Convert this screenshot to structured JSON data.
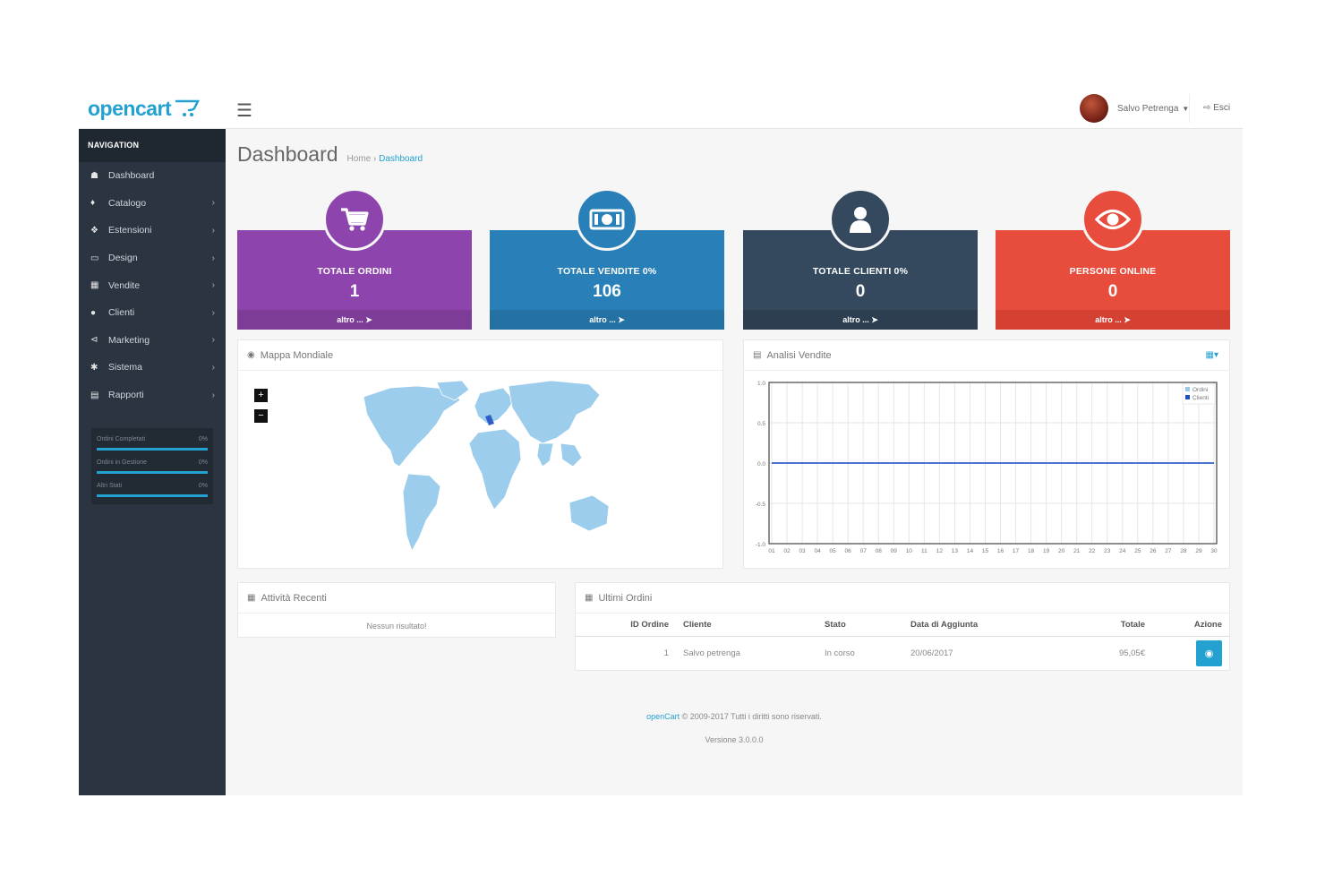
{
  "brand": {
    "logo_text": "opencart"
  },
  "header": {
    "menu_icon": "hamburger-icon",
    "user_name": "Salvo Petrenga",
    "logout_label": "Esci"
  },
  "sidebar": {
    "heading": "NAVIGATION",
    "items": [
      {
        "label": "Dashboard",
        "icon": "dashboard-icon",
        "has_children": false
      },
      {
        "label": "Catalogo",
        "icon": "tag-icon",
        "has_children": true
      },
      {
        "label": "Estensioni",
        "icon": "puzzle-icon",
        "has_children": true
      },
      {
        "label": "Design",
        "icon": "monitor-icon",
        "has_children": true
      },
      {
        "label": "Vendite",
        "icon": "cart-icon",
        "has_children": true
      },
      {
        "label": "Clienti",
        "icon": "user-icon",
        "has_children": true
      },
      {
        "label": "Marketing",
        "icon": "share-icon",
        "has_children": true
      },
      {
        "label": "Sistema",
        "icon": "gear-icon",
        "has_children": true
      },
      {
        "label": "Rapporti",
        "icon": "bar-chart-icon",
        "has_children": true
      }
    ],
    "progress": [
      {
        "label": "Ordini Completati",
        "value": "0%",
        "percent": 100
      },
      {
        "label": "Ordini in Gestione",
        "value": "0%",
        "percent": 100
      },
      {
        "label": "Altri Stati",
        "value": "0%",
        "percent": 100
      }
    ]
  },
  "page": {
    "title": "Dashboard",
    "breadcrumb": {
      "home": "Home",
      "sep": "›",
      "current": "Dashboard"
    }
  },
  "tiles": [
    {
      "title": "TOTALE ORDINI",
      "value": "1",
      "footer": "altro ...",
      "color": "#8e44ad",
      "footer_color": "#7d3c98",
      "icon": "cart-icon"
    },
    {
      "title": "TOTALE VENDITE 0%",
      "value": "106",
      "footer": "altro ...",
      "color": "#2980b9",
      "footer_color": "#2471a3",
      "icon": "money-icon"
    },
    {
      "title": "TOTALE CLIENTI 0%",
      "value": "0",
      "footer": "altro ...",
      "color": "#34495e",
      "footer_color": "#2c3e50",
      "icon": "user-icon"
    },
    {
      "title": "PERSONE ONLINE",
      "value": "0",
      "footer": "altro ...",
      "color": "#e74c3c",
      "footer_color": "#d44133",
      "icon": "eye-icon"
    }
  ],
  "map_panel": {
    "title": "Mappa Mondiale",
    "zoom_in": "+",
    "zoom_out": "−",
    "icon": "globe-icon"
  },
  "sales_panel": {
    "title": "Analisi Vendite",
    "icon": "bar-chart-icon",
    "range_icon": "calendar-icon"
  },
  "chart_data": {
    "type": "line",
    "x": [
      "01",
      "02",
      "03",
      "04",
      "05",
      "06",
      "07",
      "08",
      "09",
      "10",
      "11",
      "12",
      "13",
      "14",
      "15",
      "16",
      "17",
      "18",
      "19",
      "20",
      "21",
      "22",
      "23",
      "24",
      "25",
      "26",
      "27",
      "28",
      "29",
      "30"
    ],
    "series": [
      {
        "name": "Ordini",
        "values": [
          0,
          0,
          0,
          0,
          0,
          0,
          0,
          0,
          0,
          0,
          0,
          0,
          0,
          0,
          0,
          0,
          0,
          0,
          0,
          0,
          0,
          0,
          0,
          0,
          0,
          0,
          0,
          0,
          0,
          0
        ]
      },
      {
        "name": "Clienti",
        "values": [
          0,
          0,
          0,
          0,
          0,
          0,
          0,
          0,
          0,
          0,
          0,
          0,
          0,
          0,
          0,
          0,
          0,
          0,
          0,
          0,
          0,
          0,
          0,
          0,
          0,
          0,
          0,
          0,
          0,
          0
        ]
      }
    ],
    "yticks": [
      "1.0",
      "0.5",
      "0.0",
      "-0.5",
      "-1.0"
    ],
    "ylim": [
      -1,
      1
    ],
    "grid": true,
    "legend": "top-right",
    "colors": [
      "#9ac9e8",
      "#1e4fc4"
    ]
  },
  "activity_panel": {
    "title": "Attività Recenti",
    "icon": "calendar-icon",
    "empty_text": "Nessun risultato!"
  },
  "orders_panel": {
    "title": "Ultimi Ordini",
    "icon": "cart-icon",
    "columns": [
      "ID Ordine",
      "Cliente",
      "Stato",
      "Data di Aggiunta",
      "Totale",
      "Azione"
    ],
    "rows": [
      {
        "id": "1",
        "customer": "Salvo petrenga",
        "status": "In corso",
        "date": "20/06/2017",
        "total": "95,05€"
      }
    ]
  },
  "footer": {
    "link": "openCart",
    "copyright": "© 2009-2017 Tutti i diritti sono riservati.",
    "version": "Versione 3.0.0.0"
  },
  "colors": {
    "accent": "#23a1d1",
    "sidebar": "#2b3541",
    "sidebar_dark": "#1f2731"
  }
}
